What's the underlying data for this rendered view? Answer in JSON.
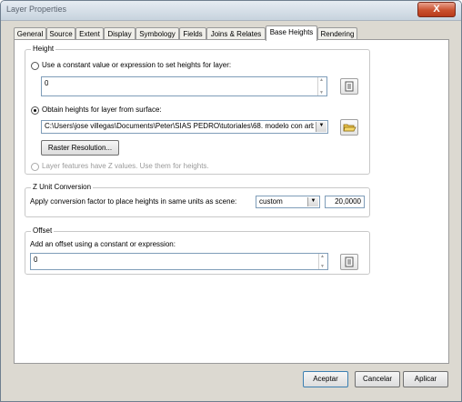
{
  "window": {
    "title": "Layer Properties",
    "close_glyph": "X"
  },
  "tabs": [
    {
      "label": "General"
    },
    {
      "label": "Source"
    },
    {
      "label": "Extent"
    },
    {
      "label": "Display"
    },
    {
      "label": "Symbology"
    },
    {
      "label": "Fields"
    },
    {
      "label": "Joins & Relates"
    },
    {
      "label": "Base Heights"
    },
    {
      "label": "Rendering"
    }
  ],
  "height_group": {
    "legend": "Height",
    "constant_radio_label": "Use a constant value or expression to set heights for layer:",
    "constant_value": "0",
    "surface_radio_label": "Obtain heights for layer from surface:",
    "surface_path": "C:\\Users\\jose villegas\\Documents\\Peter\\SIAS PEDRO\\tutoriales\\68. modelo con arb",
    "raster_resolution_button": "Raster Resolution...",
    "z_values_radio_label": "Layer features have Z values.  Use them for heights."
  },
  "z_unit_group": {
    "legend": "Z Unit Conversion",
    "description": "Apply conversion factor to place heights in same units as scene:",
    "unit_selected": "custom",
    "factor_value": "20,0000"
  },
  "offset_group": {
    "legend": "Offset",
    "description": "Add an offset using a constant or expression:",
    "offset_value": "0"
  },
  "footer": {
    "ok_label": "Aceptar",
    "cancel_label": "Cancelar",
    "apply_label": "Aplicar"
  },
  "icons": {
    "expression": "expression-icon",
    "open_folder": "open-folder-icon",
    "dropdown": "chevron-down-icon"
  }
}
